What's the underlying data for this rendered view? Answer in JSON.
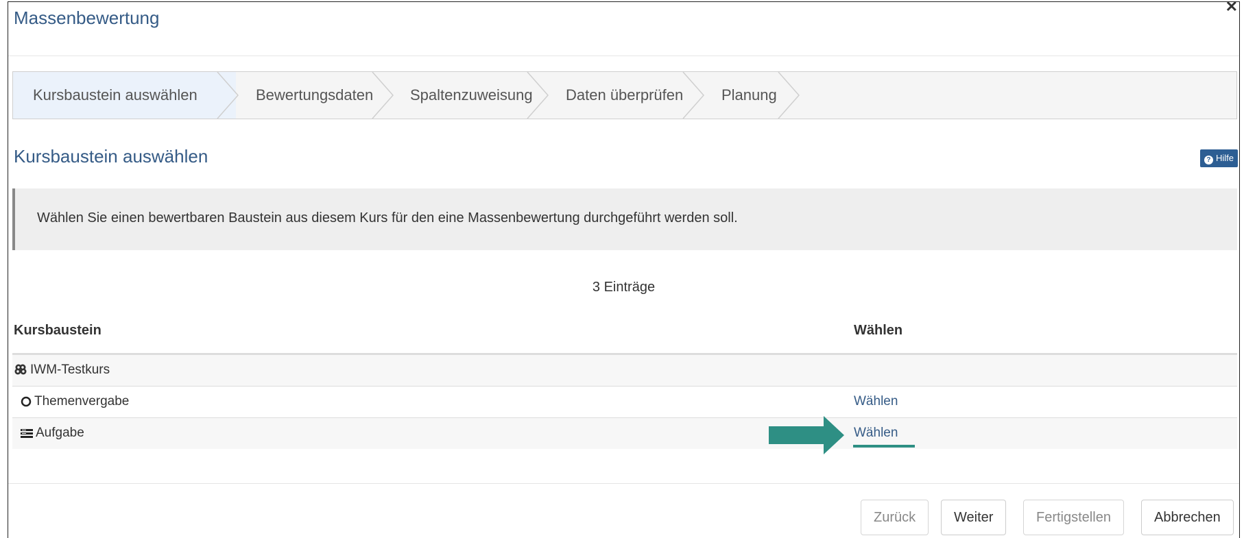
{
  "dialog": {
    "title": "Massenbewertung",
    "close_icon": "close-icon"
  },
  "wizard": {
    "steps": [
      {
        "label": "Kursbaustein auswählen",
        "active": true
      },
      {
        "label": "Bewertungsdaten",
        "active": false
      },
      {
        "label": "Spaltenzuweisung",
        "active": false
      },
      {
        "label": "Daten überprüfen",
        "active": false
      },
      {
        "label": "Planung",
        "active": false
      }
    ]
  },
  "section": {
    "title": "Kursbaustein auswählen",
    "help_label": "Hilfe",
    "help_icon": "question-circle-icon"
  },
  "info": {
    "text": "Wählen Sie einen bewertbaren Baustein aus diesem Kurs für den eine Massenbewertung durchgeführt werden soll."
  },
  "table": {
    "count_label": "3 Einträge",
    "headers": {
      "name": "Kursbaustein",
      "select": "Wählen"
    },
    "rows": [
      {
        "icon": "course-icon",
        "name": "IWM-Testkurs",
        "select": ""
      },
      {
        "icon": "circle-icon",
        "name": "Themenvergabe",
        "select": "Wählen"
      },
      {
        "icon": "task-icon",
        "name": "Aufgabe",
        "select": "Wählen"
      }
    ]
  },
  "annotation": {
    "arrow_icon": "arrow-right-icon",
    "color": "#2e8f84"
  },
  "footer": {
    "back": "Zurück",
    "next": "Weiter",
    "finish": "Fertigstellen",
    "cancel": "Abbrechen"
  },
  "colors": {
    "accent": "#355b86",
    "help_bg": "#2d5e93",
    "active_step_bg": "#ebf2fb"
  }
}
